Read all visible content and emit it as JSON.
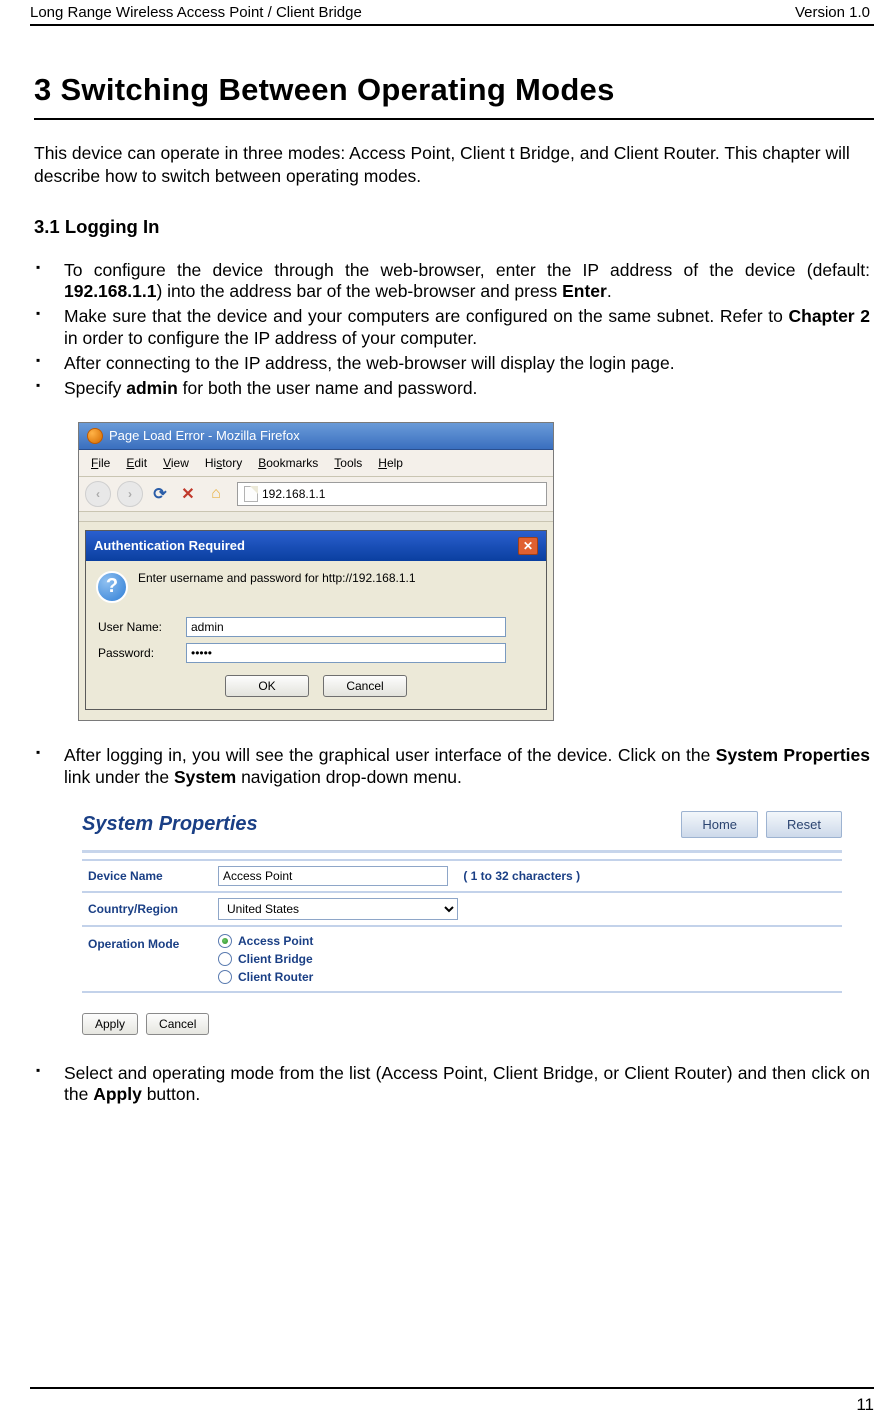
{
  "header": {
    "left": "Long Range Wireless Access Point / Client Bridge",
    "right": "Version 1.0"
  },
  "h1": "3  Switching Between Operating Modes",
  "intro": "This device can operate in three modes: Access Point, Client t Bridge, and Client Router. This chapter will describe how to switch between operating modes.",
  "h2": "3.1 Logging In",
  "bullets1": {
    "b0_pre": "To configure the device through the web-browser, enter the IP address of the device (default: ",
    "b0_ip": "192.168.1.1",
    "b0_mid": ") into the address bar of the web-browser and press ",
    "b0_enter": "Enter",
    "b0_post": ".",
    "b1_pre": "Make sure that the device and your computers are configured on the same subnet. Refer to ",
    "b1_ch": "Chapter 2",
    "b1_post": " in order to configure the IP address of your computer.",
    "b2": "After connecting to the IP address, the web-browser will display the login page.",
    "b3_pre": "Specify ",
    "b3_admin": "admin",
    "b3_post": " for both the user name and password."
  },
  "firefox": {
    "windowTitle": "Page Load Error - Mozilla Firefox",
    "menu": {
      "file": "File",
      "edit": "Edit",
      "view": "View",
      "history": "History",
      "bookmarks": "Bookmarks",
      "tools": "Tools",
      "help": "Help"
    },
    "url": "192.168.1.1",
    "auth": {
      "title": "Authentication Required",
      "message": "Enter username and password for http://192.168.1.1",
      "userLabel": "User Name:",
      "userValue": "admin",
      "passLabel": "Password:",
      "passValue": "•••••",
      "ok": "OK",
      "cancel": "Cancel"
    }
  },
  "bullets2": {
    "b0_pre": "After logging in, you will see the graphical user interface of the device. Click on the ",
    "b0_sp": "System Properties",
    "b0_mid": " link under the ",
    "b0_sys": "System",
    "b0_post": " navigation drop-down menu."
  },
  "sp": {
    "title": "System Properties",
    "btnHome": "Home",
    "btnReset": "Reset",
    "rows": {
      "deviceNameLabel": "Device Name",
      "deviceNameValue": "Access Point",
      "deviceNameHint": "( 1 to 32 characters )",
      "countryLabel": "Country/Region",
      "countryValue": "United States",
      "opModeLabel": "Operation Mode"
    },
    "options": {
      "ap": "Access Point",
      "cb": "Client Bridge",
      "cr": "Client Router"
    },
    "apply": "Apply",
    "cancel": "Cancel"
  },
  "bullets3": {
    "b0_pre": "Select and operating mode from the list (Access Point, Client Bridge, or Client Router) and then click on the ",
    "b0_apply": "Apply",
    "b0_post": " button."
  },
  "pageNumber": "11"
}
